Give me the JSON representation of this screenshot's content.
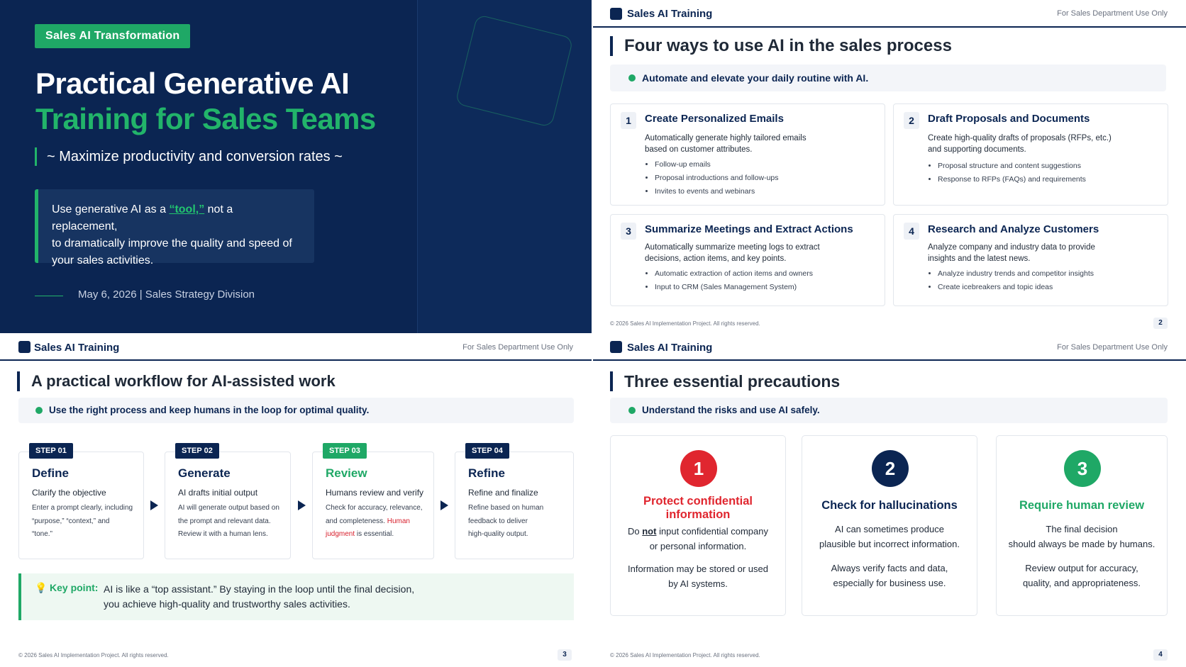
{
  "slide1": {
    "tag": "Sales AI Transformation",
    "title_line1": "Practical Generative AI",
    "title_line2": "Training for Sales Teams",
    "subtitle": "~ Maximize productivity and conversion rates ~",
    "quote_pre": "Use generative AI as a ",
    "quote_highlight": "“tool,”",
    "quote_post_line1": " not a replacement,",
    "quote_line2": "to dramatically improve the quality and speed of",
    "quote_line3": "your sales activities.",
    "date": "May 6, 2026 | Sales Strategy Division",
    "colors": {
      "navy": "#0b2552",
      "green": "#22b46a"
    }
  },
  "header": {
    "title": "Sales AI Training",
    "right": "For Sales Department Use Only"
  },
  "footer": "© 2026 Sales AI Implementation Project. All rights reserved.",
  "slide2": {
    "title": "Four ways to use AI in the sales process",
    "banner": "Automate and elevate your daily routine with AI.",
    "page": "2",
    "cards": [
      {
        "num": "1",
        "title": "Create Personalized Emails",
        "desc1": "Automatically generate highly tailored emails",
        "desc2": "based on customer attributes.",
        "bullets": [
          "Follow-up emails",
          "Proposal introductions and follow-ups",
          "Invites to events and webinars"
        ]
      },
      {
        "num": "2",
        "title": "Draft Proposals and Documents",
        "desc1": "Create high-quality drafts of proposals (RFPs, etc.)",
        "desc2": "and supporting documents.",
        "bullets": [
          "Proposal structure and content suggestions",
          "Response to RFPs (FAQs) and requirements"
        ]
      },
      {
        "num": "3",
        "title": "Summarize Meetings and Extract Actions",
        "desc1": "Automatically summarize meeting logs to extract",
        "desc2": "decisions, action items, and key points.",
        "bullets": [
          "Automatic extraction of action items and owners",
          "Input to CRM (Sales Management System)"
        ]
      },
      {
        "num": "4",
        "title": "Research and Analyze Customers",
        "desc1": "Analyze company and industry data to provide",
        "desc2": "insights and the latest news.",
        "bullets": [
          "Analyze industry trends and competitor insights",
          "Create icebreakers and topic ideas"
        ]
      }
    ]
  },
  "slide3": {
    "title": "A practical workflow for AI-assisted work",
    "banner": "Use the right process and keep humans in the loop for optimal quality.",
    "page": "3",
    "steps": [
      {
        "badge": "STEP 01",
        "title": "Define",
        "sub": "Clarify the objective",
        "d1": "Enter a prompt clearly, including",
        "d2": "“purpose,” “context,” and",
        "d3": "“tone.”"
      },
      {
        "badge": "STEP 02",
        "title": "Generate",
        "sub": "AI drafts initial output",
        "d1": "AI will generate output based on",
        "d2": "the prompt and relevant data.",
        "d3": "Review it with a human lens."
      },
      {
        "badge": "STEP 03",
        "title": "Review",
        "sub": "Humans review and verify",
        "d1": "Check for accuracy, relevance,",
        "d2": "and completeness. ",
        "d2_red": "Human",
        "d3_red": "judgment",
        "d3": " is essential."
      },
      {
        "badge": "STEP 04",
        "title": "Refine",
        "sub": "Refine and finalize",
        "d1": "Refine based on human",
        "d2": "feedback to deliver",
        "d3": "high-quality output."
      }
    ],
    "keypoint": {
      "label": "Key point:",
      "line1": "AI is like a “top assistant.”  By staying in the loop until the final decision,",
      "line2": "you achieve high-quality and trustworthy sales activities."
    }
  },
  "slide4": {
    "title": "Three essential precautions",
    "banner": "Understand the risks and use AI safely.",
    "page": "4",
    "cards": [
      {
        "num": "1",
        "color": "#e0262f",
        "title1": "Protect confidential",
        "title2": "information",
        "p1a": "Do ",
        "p1u": "not",
        "p1b": " input confidential company",
        "p1c": "or personal information.",
        "p2a": "Information may be stored or used",
        "p2b": "by AI systems."
      },
      {
        "num": "2",
        "color": "#0b2552",
        "title1": "Check for hallucinations",
        "p1a": "AI can sometimes produce",
        "p1c": "plausible but incorrect information.",
        "p2a": "Always verify facts and data,",
        "p2b": "especially for business use."
      },
      {
        "num": "3",
        "color": "#1fa866",
        "title1": "Require human review",
        "p1a": "The final decision",
        "p1c": "should always be made by humans.",
        "p2a": "Review output for accuracy,",
        "p2b": "quality, and appropriateness."
      }
    ]
  }
}
